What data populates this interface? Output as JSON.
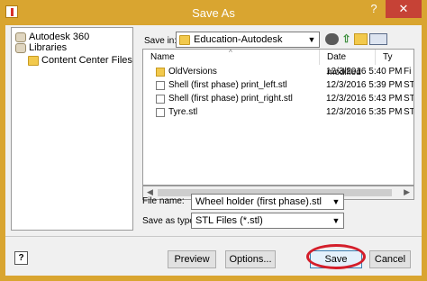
{
  "window": {
    "title": "Save As",
    "help_glyph": "?",
    "close_glyph": "✕",
    "accent_color": "#d9a530",
    "close_color": "#c64236"
  },
  "places": {
    "items": [
      {
        "label": "Autodesk 360",
        "icon": "autodesk-360-icon"
      },
      {
        "label": "Libraries",
        "icon": "libraries-icon"
      },
      {
        "label": "Content Center Files",
        "icon": "folder-icon"
      }
    ]
  },
  "save_in": {
    "label": "Save in:",
    "value": "Education-Autodesk"
  },
  "toolbar": {
    "icons": [
      "back-icon",
      "up-folder-icon",
      "new-folder-icon",
      "views-menu-icon"
    ],
    "up_glyph": "⇧"
  },
  "file_list": {
    "columns": {
      "name": "Name",
      "date": "Date modified",
      "type": "Ty"
    },
    "rows": [
      {
        "name": "OldVersions",
        "date": "12/3/2016 5:40 PM",
        "type": "Fi",
        "kind": "folder"
      },
      {
        "name": "Shell (first phase) print_left.stl",
        "date": "12/3/2016 5:39 PM",
        "type": "ST",
        "kind": "file"
      },
      {
        "name": "Shell (first phase) print_right.stl",
        "date": "12/3/2016 5:43 PM",
        "type": "ST",
        "kind": "file"
      },
      {
        "name": "Tyre.stl",
        "date": "12/3/2016 5:35 PM",
        "type": "ST",
        "kind": "file"
      }
    ]
  },
  "file_name": {
    "label": "File name:",
    "value": "Wheel holder (first phase).stl"
  },
  "save_as_type": {
    "label": "Save as type:",
    "value": "STL Files (*.stl)"
  },
  "buttons": {
    "help": "?",
    "preview": "Preview",
    "options": "Options...",
    "save": "Save",
    "cancel": "Cancel"
  },
  "highlight_color": "#d41e2a"
}
